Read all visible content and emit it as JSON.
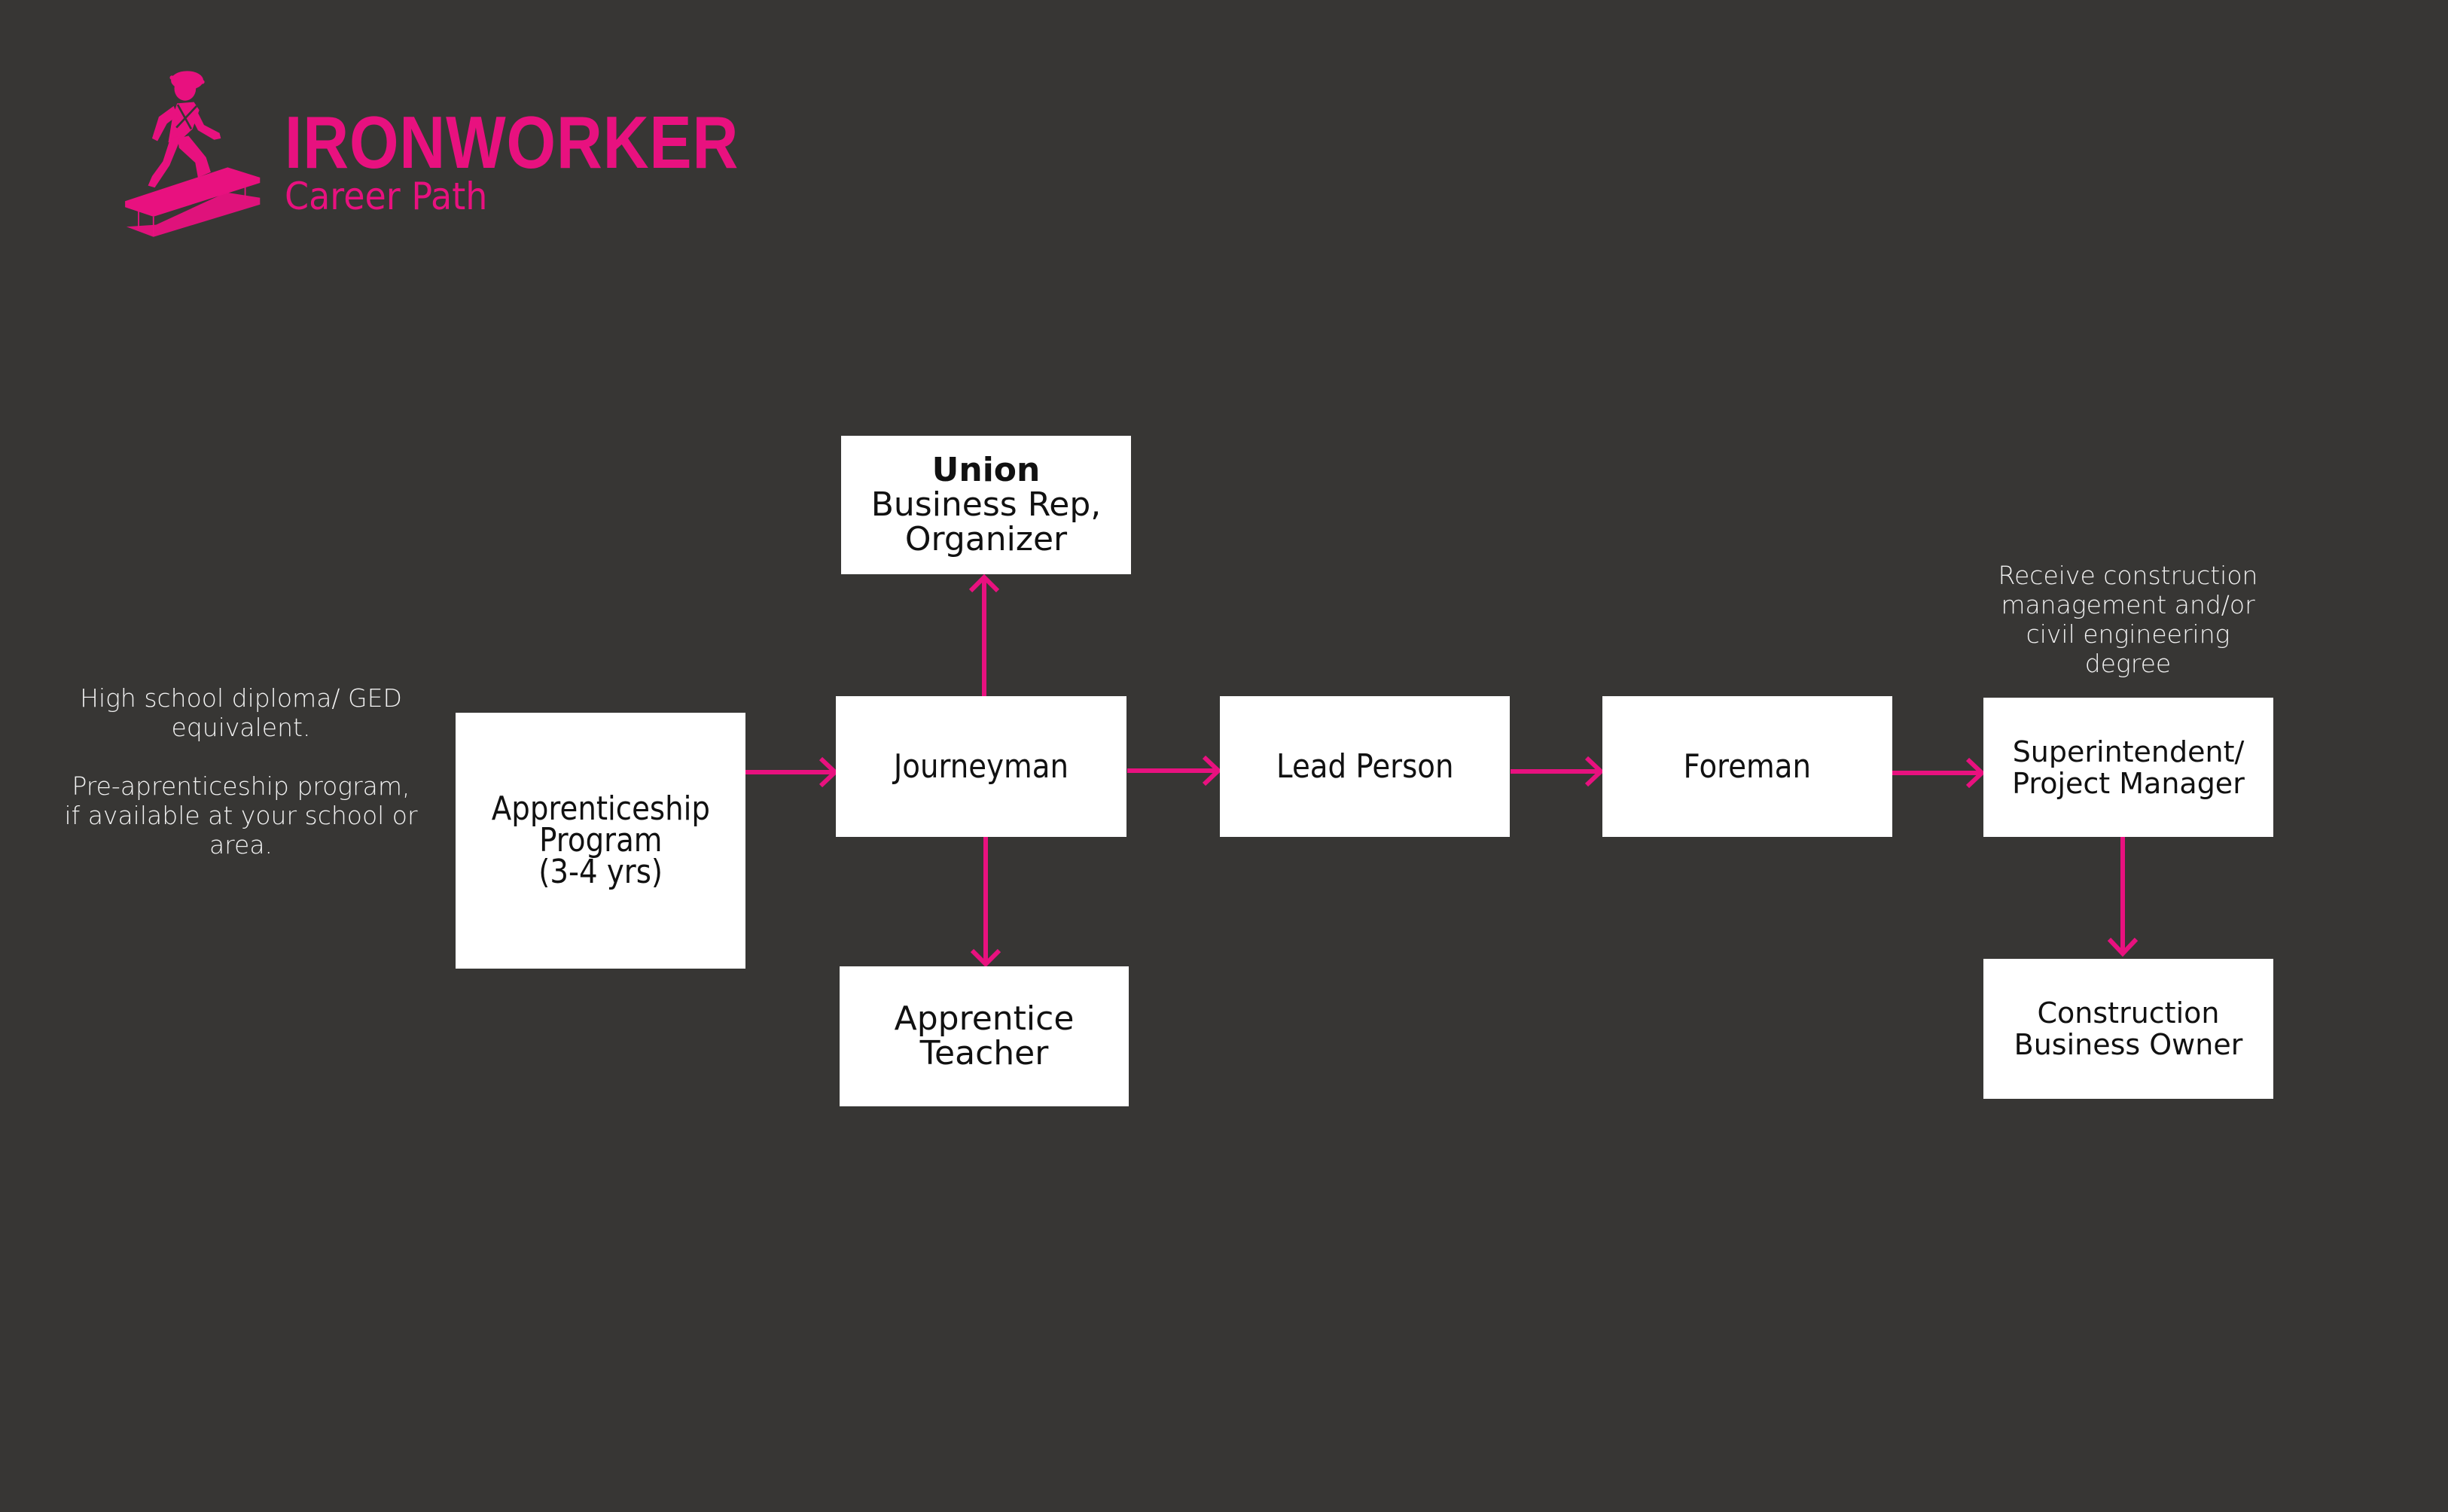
{
  "header": {
    "title": "IRONWORKER",
    "subtitle": "Career Path",
    "logo_icon": "ironworker-on-ibeam-icon"
  },
  "colors": {
    "background": "#373634",
    "accent": "#E8117F",
    "node_fill": "#FFFFFF",
    "node_text": "#111111",
    "note_text": "#F1F1F1"
  },
  "notes": {
    "entry": "High school diploma/ GED\nequivalent.\n\nPre-aprenticeship program,\nif available at your school or\narea.",
    "degree": "Receive construction\nmanagement and/or\ncivil engineering\ndegree"
  },
  "nodes": {
    "apprenticeship": {
      "lines": [
        "Apprenticeship",
        "Program",
        "(3-4 yrs)"
      ]
    },
    "journeyman": {
      "lines": [
        "Journeyman"
      ]
    },
    "union": {
      "heading": "Union",
      "lines": [
        "Business Rep,",
        "Organizer"
      ]
    },
    "apprentice_teacher": {
      "lines": [
        "Apprentice",
        "Teacher"
      ]
    },
    "lead_person": {
      "lines": [
        "Lead Person"
      ]
    },
    "foreman": {
      "lines": [
        "Foreman"
      ]
    },
    "superintendent": {
      "lines": [
        "Superintendent/",
        "Project Manager"
      ]
    },
    "business_owner": {
      "lines": [
        "Construction",
        "Business Owner"
      ]
    }
  },
  "edges": [
    {
      "from": "apprenticeship",
      "to": "journeyman"
    },
    {
      "from": "journeyman",
      "to": "union"
    },
    {
      "from": "journeyman",
      "to": "apprentice_teacher"
    },
    {
      "from": "journeyman",
      "to": "lead_person"
    },
    {
      "from": "lead_person",
      "to": "foreman"
    },
    {
      "from": "foreman",
      "to": "superintendent"
    },
    {
      "from": "superintendent",
      "to": "business_owner"
    }
  ]
}
